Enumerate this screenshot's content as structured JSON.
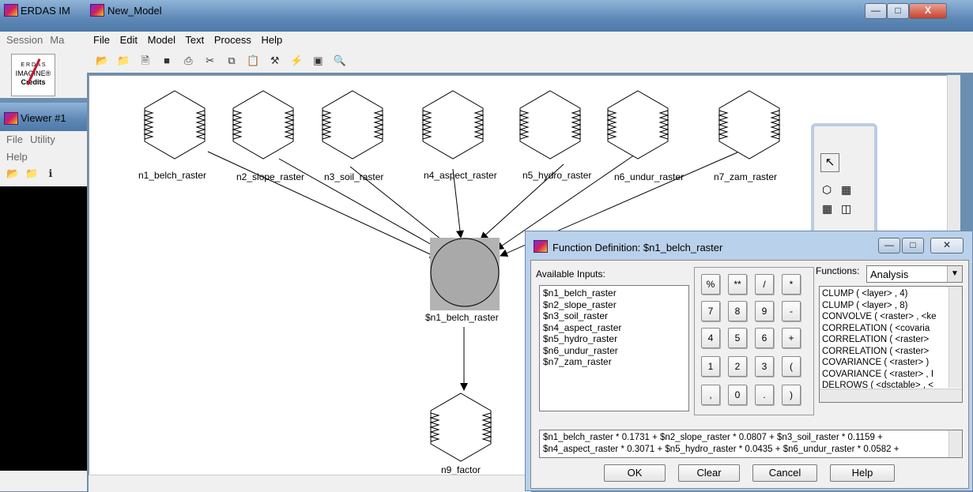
{
  "erdas_window": {
    "title": "ERDAS IM",
    "menu": [
      "Session",
      "Ma"
    ],
    "logo_line1": "E R D A S",
    "logo_line2": "IMAGINE®",
    "logo_line3": "Credits"
  },
  "viewer_window": {
    "title": "Viewer #1",
    "menu": [
      "File",
      "Utility",
      "Help"
    ]
  },
  "model_window": {
    "title": "New_Model",
    "menu": [
      "File",
      "Edit",
      "Model",
      "Text",
      "Process",
      "Help"
    ],
    "toolbar_icons": [
      "open-icon",
      "open-folder-icon",
      "new-icon",
      "save-icon",
      "print-icon",
      "cut-icon",
      "copy-icon",
      "paste-icon",
      "hammer-icon",
      "lightning-icon",
      "fit-icon",
      "zoom-icon"
    ],
    "nodes": {
      "n1": "n1_belch_raster",
      "n2": "n2_slope_raster",
      "n3": "n3_soil_raster",
      "n4": "n4_aspect_raster",
      "n5": "n5_hydro_raster",
      "n6": "n6_undur_raster",
      "n7": "n7_zam_raster",
      "function": "$n1_belch_raster",
      "output": "n9_factor"
    }
  },
  "function_dialog": {
    "title": "Function Definition:  $n1_belch_raster",
    "available_inputs_label": "Available Inputs:",
    "inputs": [
      "$n1_belch_raster",
      "$n2_slope_raster",
      "$n3_soil_raster",
      "$n4_aspect_raster",
      "$n5_hydro_raster",
      "$n6_undur_raster",
      "$n7_zam_raster"
    ],
    "keypad": {
      "r1": [
        "%",
        "**",
        "/",
        "*"
      ],
      "r2": [
        "7",
        "8",
        "9",
        "-"
      ],
      "r3": [
        "4",
        "5",
        "6",
        "+"
      ],
      "r4": [
        "1",
        "2",
        "3",
        "("
      ],
      "r5": [
        ",",
        "0",
        ".",
        ")"
      ]
    },
    "functions_label": "Functions:",
    "functions_select": "Analysis",
    "functions": [
      "CLUMP ( <layer> , 4)",
      "CLUMP ( <layer> , 8)",
      "CONVOLVE ( <raster> , <ke",
      "CORRELATION ( <covaria",
      "CORRELATION ( <raster>",
      "CORRELATION ( <raster>",
      "COVARIANCE ( <raster> )",
      "COVARIANCE ( <raster> , I",
      "DELROWS ( <dsctable> , <"
    ],
    "expression_line1": "$n1_belch_raster * 0.1731 + $n2_slope_raster * 0.0807 + $n3_soil_raster * 0.1159 +",
    "expression_line2": "$n4_aspect_raster * 0.3071 + $n5_hydro_raster * 0.0435 + $n6_undur_raster * 0.0582 +",
    "buttons": {
      "ok": "OK",
      "clear": "Clear",
      "cancel": "Cancel",
      "help": "Help"
    }
  }
}
